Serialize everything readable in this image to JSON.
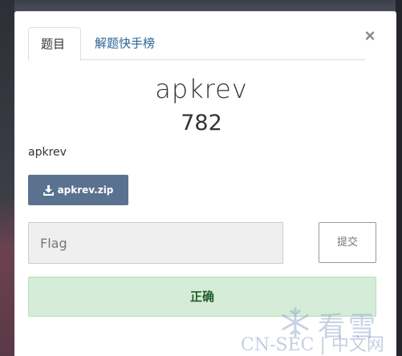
{
  "tabs": [
    {
      "label": "题目",
      "active": true
    },
    {
      "label": "解题快手榜",
      "active": false
    }
  ],
  "close_label": "×",
  "challenge": {
    "name": "apkrev",
    "points": "782",
    "description": "apkrev",
    "file_label": "apkrev.zip"
  },
  "flag_input": {
    "placeholder": "Flag",
    "value": ""
  },
  "submit_label": "提交",
  "result_message": "正确",
  "watermark": {
    "brand": "看雪",
    "footer": "CN-SEC | 中文网"
  },
  "colors": {
    "download_button": "#5b7190",
    "result_bg": "#d4ecd8",
    "result_text": "#245c2a",
    "tab_link": "#2a6496"
  }
}
